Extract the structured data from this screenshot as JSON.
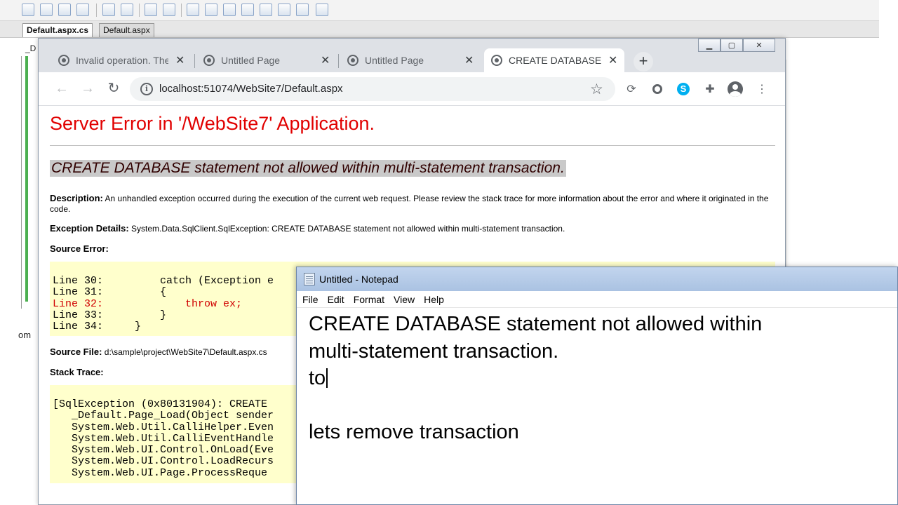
{
  "vs": {
    "tabs": [
      "Default.aspx.cs",
      "Default.aspx"
    ],
    "side_text": [
      "_D",
      "om"
    ]
  },
  "chrome": {
    "tabs": [
      {
        "label": "Invalid operation. The",
        "active": false
      },
      {
        "label": "Untitled Page",
        "active": false
      },
      {
        "label": "Untitled Page",
        "active": false
      },
      {
        "label": "CREATE DATABASE s",
        "active": true
      }
    ],
    "url": "localhost:51074/WebSite7/Default.aspx",
    "window_controls": [
      "minimize-icon",
      "maximize-icon",
      "close-icon"
    ],
    "extensions": [
      "sync-icon",
      "circle-extension-icon",
      "skype-icon",
      "puzzle-icon",
      "profile-avatar-icon",
      "more-vert-icon"
    ]
  },
  "page": {
    "title": "Server Error in '/WebSite7' Application.",
    "message": "CREATE DATABASE statement not allowed within multi-statement transaction.",
    "description_label": "Description:",
    "description": "An unhandled exception occurred during the execution of the current web request. Please review the stack trace for more information about the error and where it originated in the code.",
    "exception_label": "Exception Details:",
    "exception": "System.Data.SqlClient.SqlException: CREATE DATABASE statement not allowed within multi-statement transaction.",
    "source_error_label": "Source Error:",
    "source_lines": [
      {
        "text": "Line 30:         catch (Exception e",
        "highlight": false
      },
      {
        "text": "Line 31:         {",
        "highlight": false
      },
      {
        "text": "Line 32:             throw ex;",
        "highlight": true
      },
      {
        "text": "Line 33:         }",
        "highlight": false
      },
      {
        "text": "Line 34:     }",
        "highlight": false
      }
    ],
    "source_file_label": "Source File:",
    "source_file": "d:\\sample\\project\\WebSite7\\Default.aspx.cs",
    "stack_trace_label": "Stack Trace:",
    "stack_lines": [
      "[SqlException (0x80131904): CREATE",
      "   _Default.Page_Load(Object sender",
      "   System.Web.Util.CalliHelper.Even",
      "   System.Web.Util.CalliEventHandle",
      "   System.Web.UI.Control.OnLoad(Eve",
      "   System.Web.UI.Control.LoadRecurs",
      "   System.Web.UI.Page.ProcessReque"
    ]
  },
  "notepad": {
    "title": "Untitled - Notepad",
    "menu": [
      "File",
      "Edit",
      "Format",
      "View",
      "Help"
    ],
    "lines": [
      "CREATE DATABASE statement not allowed within",
      "multi-statement transaction.",
      "to",
      "",
      "lets remove transaction"
    ]
  }
}
